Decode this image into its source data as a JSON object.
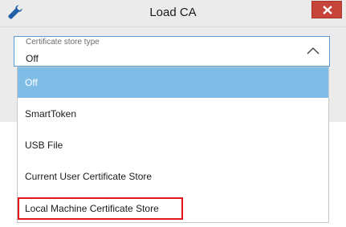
{
  "window": {
    "title": "Load CA",
    "app_icon": "wrench-icon",
    "close_icon": "close-icon"
  },
  "select": {
    "label": "Certificate store type",
    "value": "Off",
    "expanded_icon": "chevron-up-icon",
    "options": [
      {
        "label": "Off",
        "selected": true
      },
      {
        "label": "SmartToken",
        "selected": false
      },
      {
        "label": "USB File",
        "selected": false
      },
      {
        "label": "Current User Certificate Store",
        "selected": false
      },
      {
        "label": "Local Machine Certificate Store",
        "selected": false,
        "annotated": true
      }
    ]
  },
  "colors": {
    "accent": "#7fbde6",
    "close": "#c7443a",
    "annotation": "#e3161e",
    "focus_border": "#5a9bd5"
  }
}
